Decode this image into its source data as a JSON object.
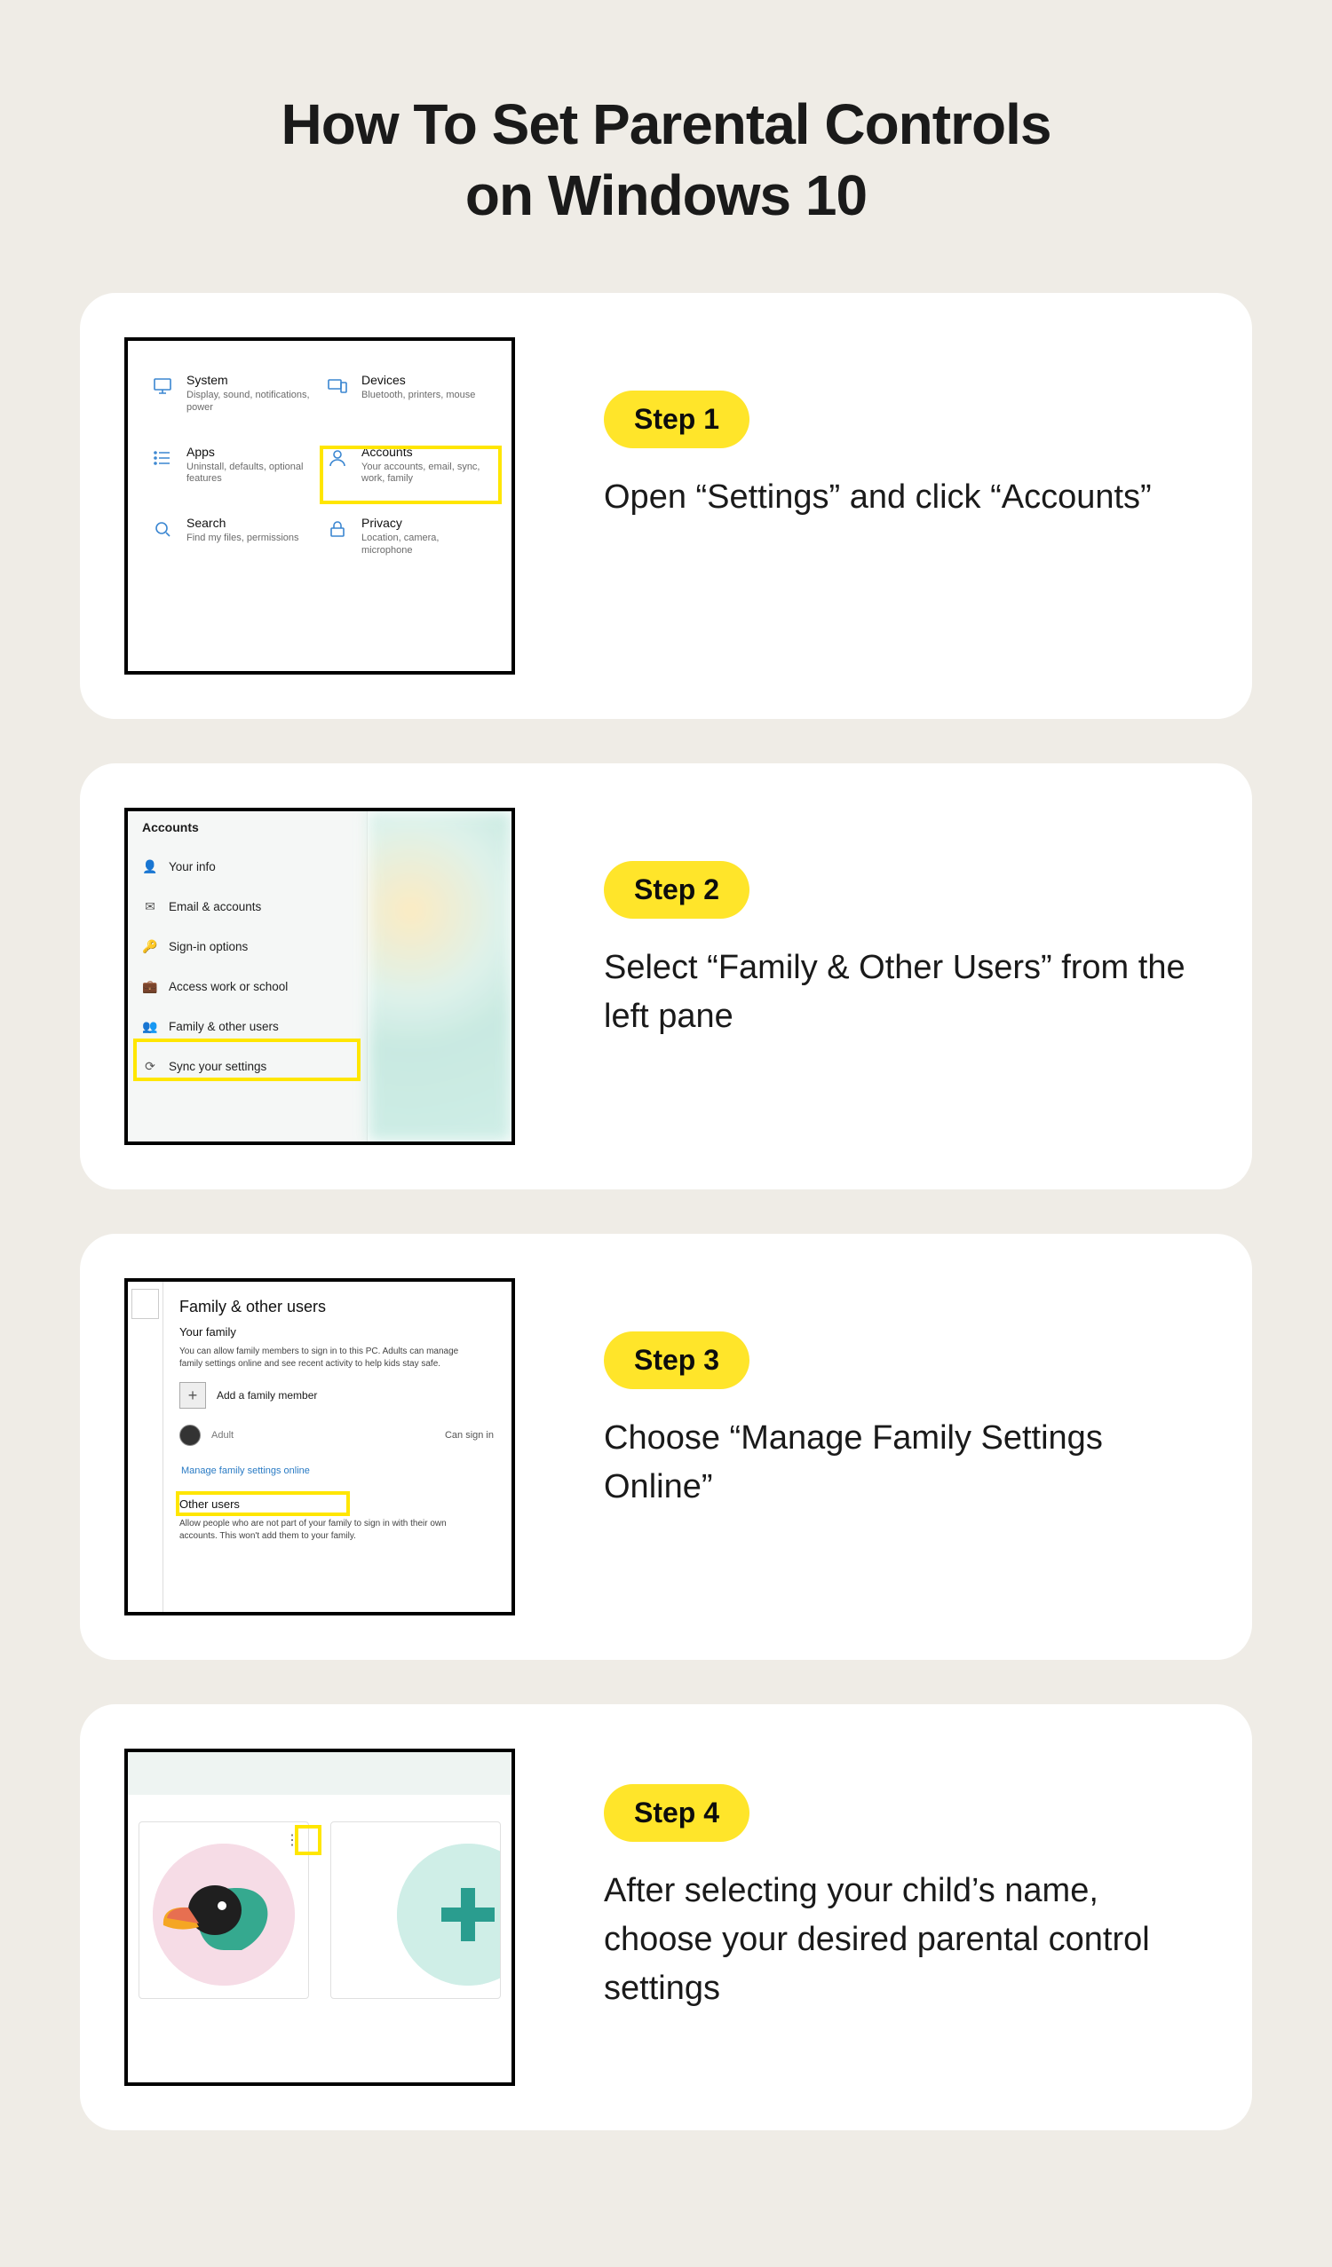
{
  "title_line1": "How To Set Parental Controls",
  "title_line2": "on Windows 10",
  "highlight_color": "#ffe600",
  "accent_color": "#ffe52a",
  "steps": [
    {
      "pill": "Step 1",
      "text": "Open “Settings” and click “Accounts”"
    },
    {
      "pill": "Step 2",
      "text": "Select “Family & Other Users” from the left pane"
    },
    {
      "pill": "Step 3",
      "text": "Choose “Manage Family Settings Online”"
    },
    {
      "pill": "Step 4",
      "text": "After selecting your child’s name, choose your desired parental control settings"
    }
  ],
  "settings_items": [
    {
      "label": "System",
      "sub": "Display, sound, notifications, power",
      "icon": "monitor"
    },
    {
      "label": "Devices",
      "sub": "Bluetooth, printers, mouse",
      "icon": "devices"
    },
    {
      "label": "Apps",
      "sub": "Uninstall, defaults, optional features",
      "icon": "list"
    },
    {
      "label": "Accounts",
      "sub": "Your accounts, email, sync, work, family",
      "icon": "person",
      "highlight": true
    },
    {
      "label": "Search",
      "sub": "Find my files, permissions",
      "icon": "search"
    },
    {
      "label": "Privacy",
      "sub": "Location, camera, microphone",
      "icon": "lock"
    }
  ],
  "accounts_sidebar": {
    "title": "Accounts",
    "items": [
      {
        "icon": "👤",
        "label": "Your info"
      },
      {
        "icon": "✉",
        "label": "Email & accounts"
      },
      {
        "icon": "🔑",
        "label": "Sign-in options"
      },
      {
        "icon": "💼",
        "label": "Access work or school"
      },
      {
        "icon": "👥",
        "label": "Family & other users",
        "highlight": true
      },
      {
        "icon": "⟳",
        "label": "Sync your settings"
      }
    ]
  },
  "family_page": {
    "heading": "Family & other users",
    "your_family": "Your family",
    "family_desc": "You can allow family members to sign in to this PC. Adults can manage family settings online and see recent activity to help kids stay safe.",
    "add_member": "Add a family member",
    "adult_label": "Adult",
    "can_sign_in": "Can sign in",
    "manage_link": "Manage family settings online",
    "other_users": "Other users",
    "other_desc": "Allow people who are not part of your family to sign in with their own accounts. This won't add them to your family."
  }
}
